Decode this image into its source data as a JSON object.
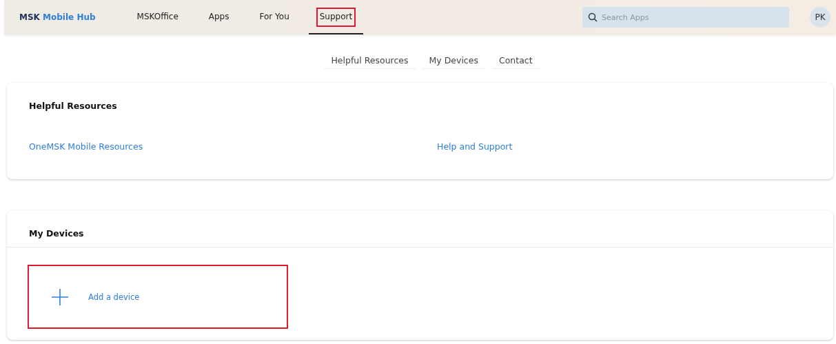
{
  "header": {
    "brand": {
      "prefix": "MSK",
      "name": "Mobile Hub"
    },
    "nav": [
      {
        "label": "MSKOffice",
        "selected": false,
        "highlighted": false
      },
      {
        "label": "Apps",
        "selected": false,
        "highlighted": false
      },
      {
        "label": "For You",
        "selected": false,
        "highlighted": false
      },
      {
        "label": "Support",
        "selected": true,
        "highlighted": true
      }
    ],
    "search": {
      "placeholder": "Search Apps"
    },
    "avatar": "PK"
  },
  "subnav": [
    "Helpful Resources",
    "My Devices",
    "Contact"
  ],
  "resources": {
    "title": "Helpful Resources",
    "links": [
      "OneMSK Mobile Resources",
      "Help and Support"
    ]
  },
  "devices": {
    "title": "My Devices",
    "add": {
      "label": "Add a device",
      "highlighted": true
    }
  }
}
